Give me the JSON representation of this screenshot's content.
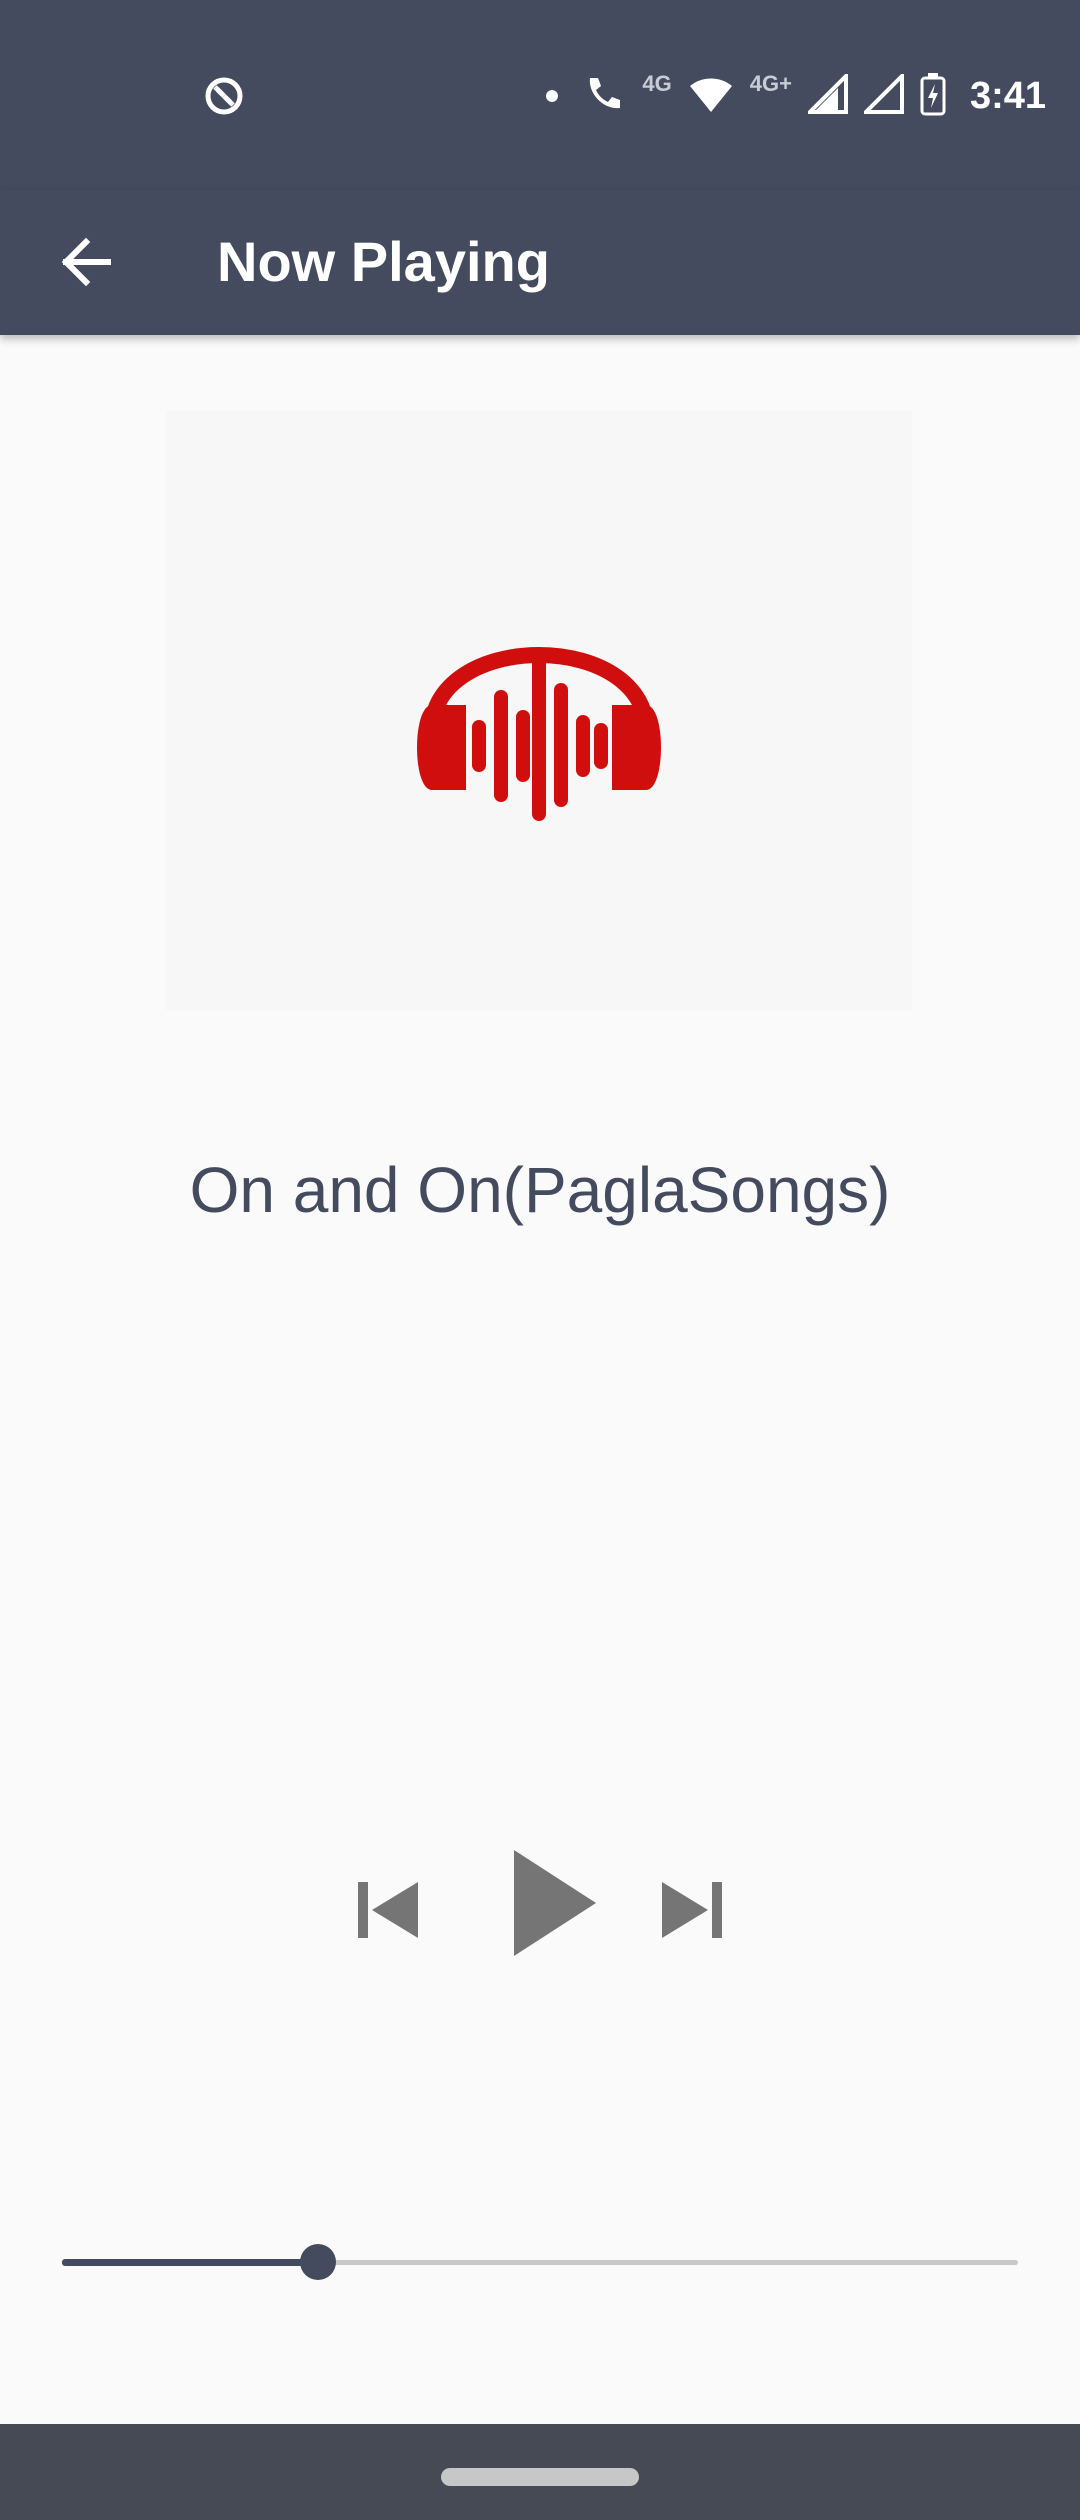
{
  "status_bar": {
    "time": "3:41",
    "network_label": "4G",
    "network_label_2": "4G+",
    "icons": [
      "data-saver-icon",
      "notification-dot-icon",
      "volte-call-icon",
      "wifi-icon",
      "signal-icon",
      "signal-icon-2",
      "battery-charging-icon"
    ]
  },
  "app_bar": {
    "title": "Now Playing",
    "back_icon": "back-arrow-icon"
  },
  "album_art": {
    "icon": "headphones-sound-icon",
    "accent_color": "#d10e0e"
  },
  "track": {
    "title": "On and On(PaglaSongs)"
  },
  "controls": {
    "previous_icon": "skip-previous-icon",
    "play_icon": "play-icon",
    "next_icon": "skip-next-icon",
    "icon_color": "#757575"
  },
  "seek_bar": {
    "progress_fraction": 0.268
  },
  "colors": {
    "primary": "#454b5f",
    "background": "#fafafa"
  }
}
